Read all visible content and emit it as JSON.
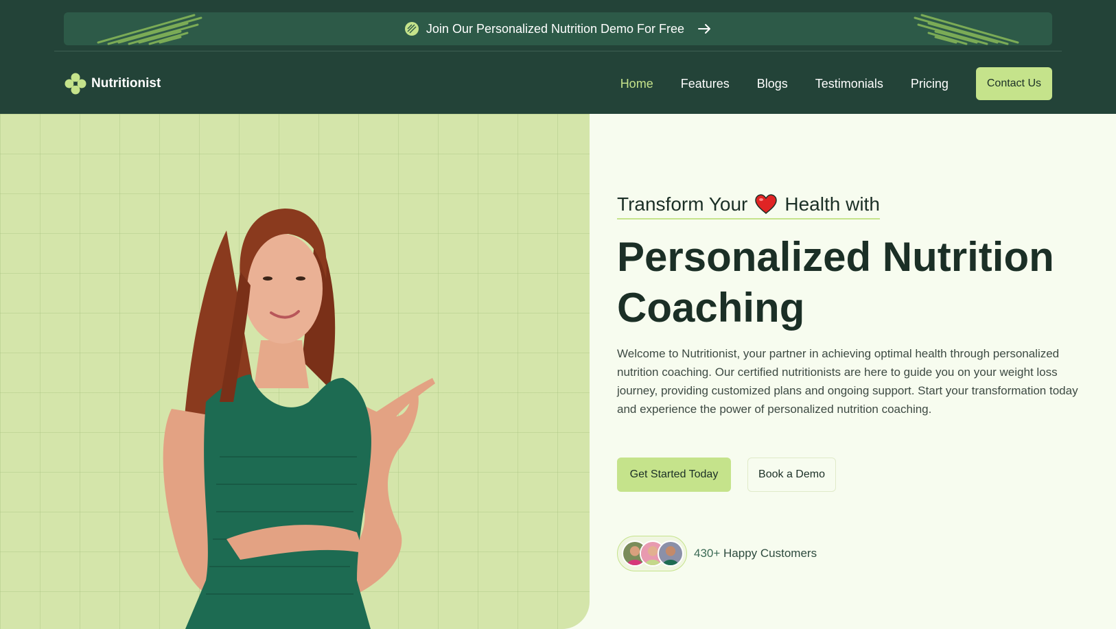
{
  "announcement": {
    "text": "Join Our Personalized Nutrition Demo For Free",
    "icon": "leaf-badge-icon",
    "arrow_icon": "arrow-right-icon"
  },
  "nav": {
    "logo_text": "Nutritionist",
    "logo_icon": "clover-icon",
    "items": [
      {
        "label": "Home",
        "active": true
      },
      {
        "label": "Features",
        "active": false
      },
      {
        "label": "Blogs",
        "active": false
      },
      {
        "label": "Testimonials",
        "active": false
      },
      {
        "label": "Pricing",
        "active": false
      }
    ],
    "contact_label": "Contact Us"
  },
  "hero": {
    "tagline_part1": "Transform Your",
    "tagline_part2": "Health with",
    "headline": "Personalized Nutrition Coaching",
    "description": "Welcome to Nutritionist, your partner in achieving optimal health through personalized nutrition coaching. Our certified nutritionists are here to guide you on your weight loss journey, providing customized plans and ongoing support. Start your transformation today and experience the power of personalized nutrition coaching.",
    "primary_cta": "Get Started Today",
    "secondary_cta": "Book a Demo",
    "customers_count": "430+",
    "customers_label": "Happy Customers"
  },
  "colors": {
    "dark_green": "#234338",
    "accent_lime": "#c5e38b",
    "hero_bg": "#f7fcef",
    "photo_bg": "#d4e5aa",
    "text_dark": "#1b2f26"
  }
}
